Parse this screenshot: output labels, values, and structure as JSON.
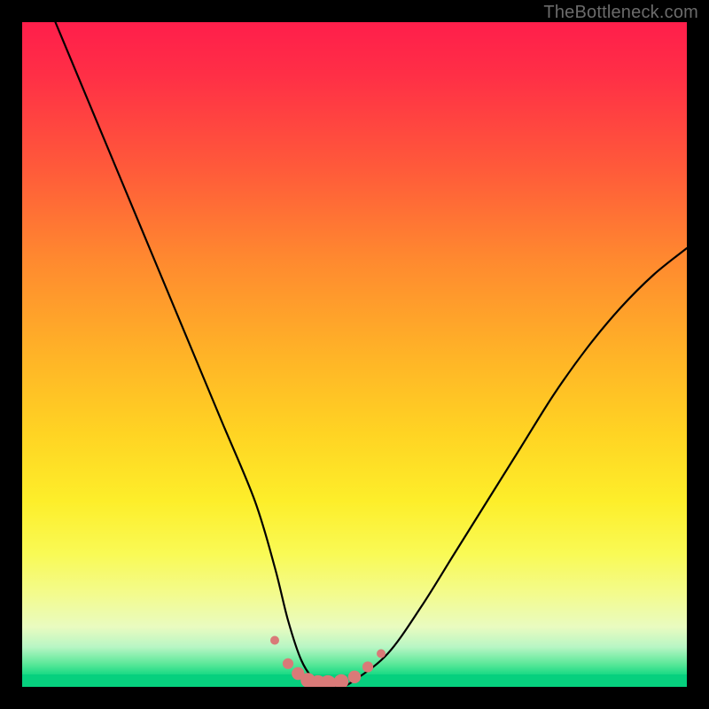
{
  "attribution": "TheBottleneck.com",
  "colors": {
    "background": "#000000",
    "gradient_top": "#ff1e4b",
    "gradient_bottom": "#06d07e",
    "curve": "#000000",
    "dots": "#d97a78"
  },
  "chart_data": {
    "type": "line",
    "title": "",
    "xlabel": "",
    "ylabel": "",
    "xlim": [
      0,
      100
    ],
    "ylim": [
      0,
      100
    ],
    "grid": false,
    "legend": false,
    "annotations": [
      "TheBottleneck.com"
    ],
    "series": [
      {
        "name": "bottleneck-curve",
        "x": [
          5,
          10,
          15,
          20,
          25,
          30,
          35,
          38,
          40,
          42,
          44,
          46,
          48,
          50,
          55,
          60,
          65,
          70,
          75,
          80,
          85,
          90,
          95,
          100
        ],
        "values": [
          100,
          88,
          76,
          64,
          52,
          40,
          28,
          18,
          10,
          4,
          1,
          0,
          0,
          1,
          5,
          12,
          20,
          28,
          36,
          44,
          51,
          57,
          62,
          66
        ]
      }
    ],
    "markers": {
      "name": "valley-dots",
      "x": [
        38,
        40,
        41.5,
        43,
        44.5,
        46,
        48,
        50,
        52,
        54
      ],
      "values": [
        7,
        3.5,
        2,
        1,
        0.5,
        0.5,
        0.8,
        1.5,
        3,
        5
      ]
    }
  }
}
